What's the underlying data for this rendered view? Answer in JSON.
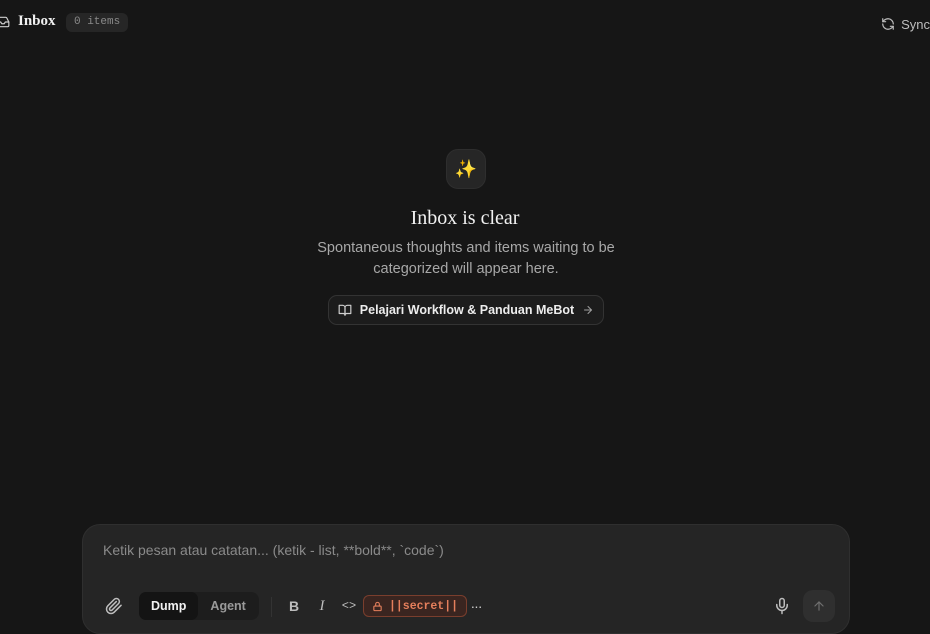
{
  "header": {
    "title": "Inbox",
    "count_badge": "0 items",
    "sync_label": "Sync"
  },
  "empty_state": {
    "icon": "sparkles-icon",
    "icon_glyph": "✨",
    "title": "Inbox is clear",
    "description": "Spontaneous thoughts and items waiting to be categorized will appear here.",
    "guide_button_label": "Pelajari Workflow & Panduan MeBot"
  },
  "composer": {
    "placeholder": "Ketik pesan atau catatan... (ketik - list, **bold**, `code`)",
    "value": "",
    "modes": [
      "Dump",
      "Agent"
    ],
    "active_mode": "Dump",
    "format_tools": {
      "bold": "B",
      "italic": "I",
      "code": "<>",
      "secret": "||secret||",
      "more": "···"
    }
  },
  "colors": {
    "background": "#161616",
    "composer": "#252525",
    "secret_accent": "#e57f5c"
  }
}
